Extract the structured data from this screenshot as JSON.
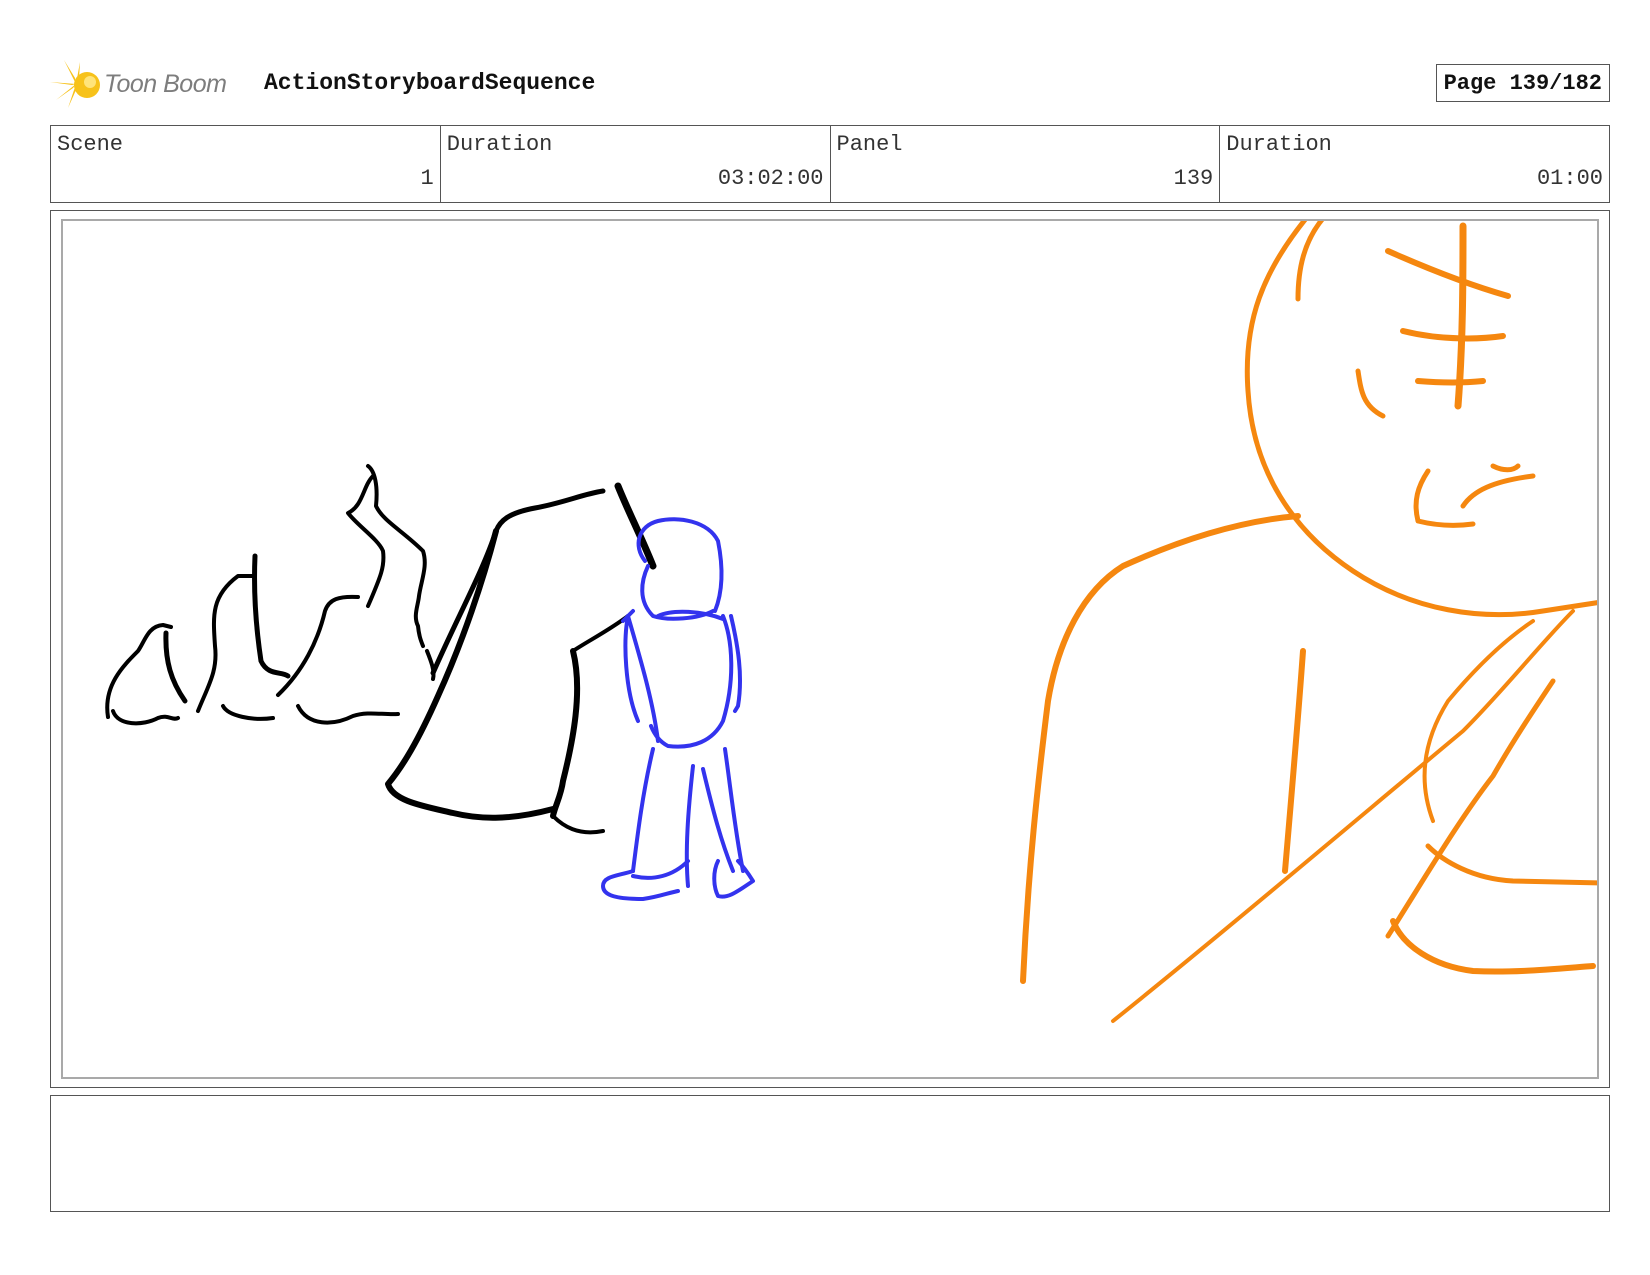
{
  "header": {
    "logo_text": "Toon Boom",
    "sequence_title": "ActionStoryboardSequence",
    "page_label": "Page 139/182"
  },
  "info": {
    "scene_label": "Scene",
    "scene_value": "1",
    "scene_duration_label": "Duration",
    "scene_duration_value": "03:02:00",
    "panel_label": "Panel",
    "panel_value": "139",
    "panel_duration_label": "Duration",
    "panel_duration_value": "01:00"
  },
  "notes": {
    "text": ""
  },
  "colors": {
    "rocks": "#000000",
    "astronaut": "#3333ee",
    "foreground_character": "#f5870f",
    "logo_yellow": "#f7c21a",
    "frame_border": "#555555"
  }
}
